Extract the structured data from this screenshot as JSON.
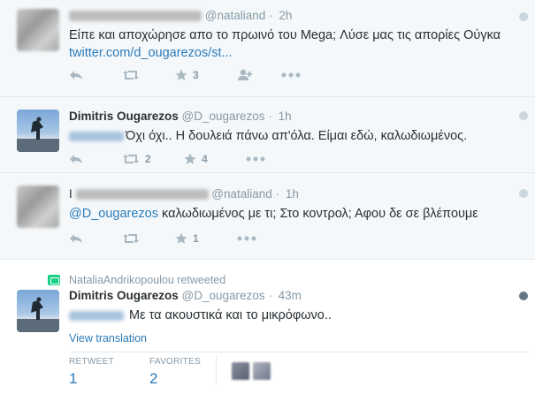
{
  "colors": {
    "link": "#2b7bb9",
    "muted": "#8899a6",
    "retweet_green": "#19cf86"
  },
  "tweets": [
    {
      "username": "@nataliand",
      "time": "2h",
      "text": "Είπε και αποχώρησε απο το πρωινό του Mega; Λύσε μας τις απορίες Ούγκα",
      "link": "twitter.com/d_ougarezos/st...",
      "retweets": "",
      "favorites": "3"
    },
    {
      "fullname": "Dimitris Ougarezos",
      "username": "@D_ougarezos",
      "time": "1h",
      "text": "Όχι όχι.. Η δουλειά πάνω απ'όλα. Είμαι εδώ, καλωδιωμένος.",
      "retweets": "2",
      "favorites": "4"
    },
    {
      "name_prefix": "I",
      "username": "@nataliand",
      "time": "1h",
      "mention": "@D_ougarezos",
      "text": "καλωδιωμένος με τι; Στο κοντρολ; Αφου δε σε βλέπουμε",
      "retweets": "",
      "favorites": "1"
    },
    {
      "retweeted_by": "NataliaAndrikopoulou retweeted",
      "fullname": "Dimitris Ougarezos",
      "username": "@D_ougarezos",
      "time": "43m",
      "text": "Με τα ακουστικά και το μικρόφωνο..",
      "view_translation": "View translation",
      "stats": {
        "retweet_label": "RETWEET",
        "retweet_count": "1",
        "favorites_label": "FAVORITES",
        "favorites_count": "2"
      }
    }
  ]
}
